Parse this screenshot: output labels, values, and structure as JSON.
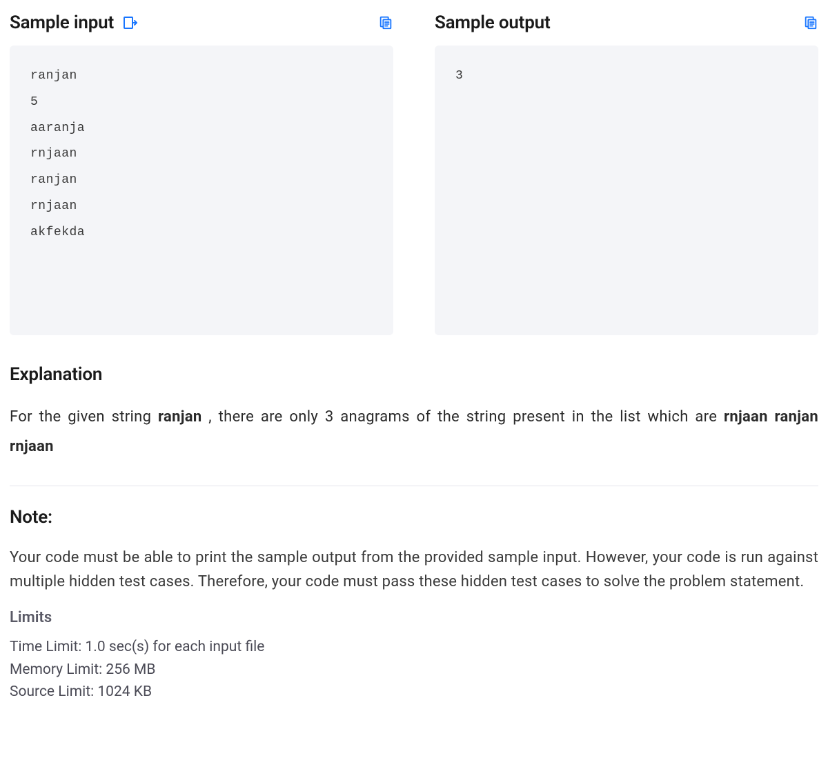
{
  "sample_input": {
    "title": "Sample input",
    "content": "ranjan\n5\naaranja\nrnjaan\nranjan\nrnjaan\nakfekda"
  },
  "sample_output": {
    "title": "Sample output",
    "content": "3"
  },
  "explanation": {
    "title": "Explanation",
    "lead": "For the given string ",
    "target": "ranjan",
    "mid": " , there are only 3 anagrams of the string present in the list which are ",
    "anagrams": "rnjaan ranjan rnjaan"
  },
  "note": {
    "title": "Note:",
    "body": "Your code must be able to print the sample output from the provided sample input. However, your code is run against multiple hidden test cases. Therefore, your code must pass these hidden test cases to solve the problem statement."
  },
  "limits": {
    "title": "Limits",
    "time": "Time Limit: 1.0 sec(s) for each input file",
    "memory": "Memory Limit: 256 MB",
    "source": "Source Limit: 1024 KB"
  }
}
